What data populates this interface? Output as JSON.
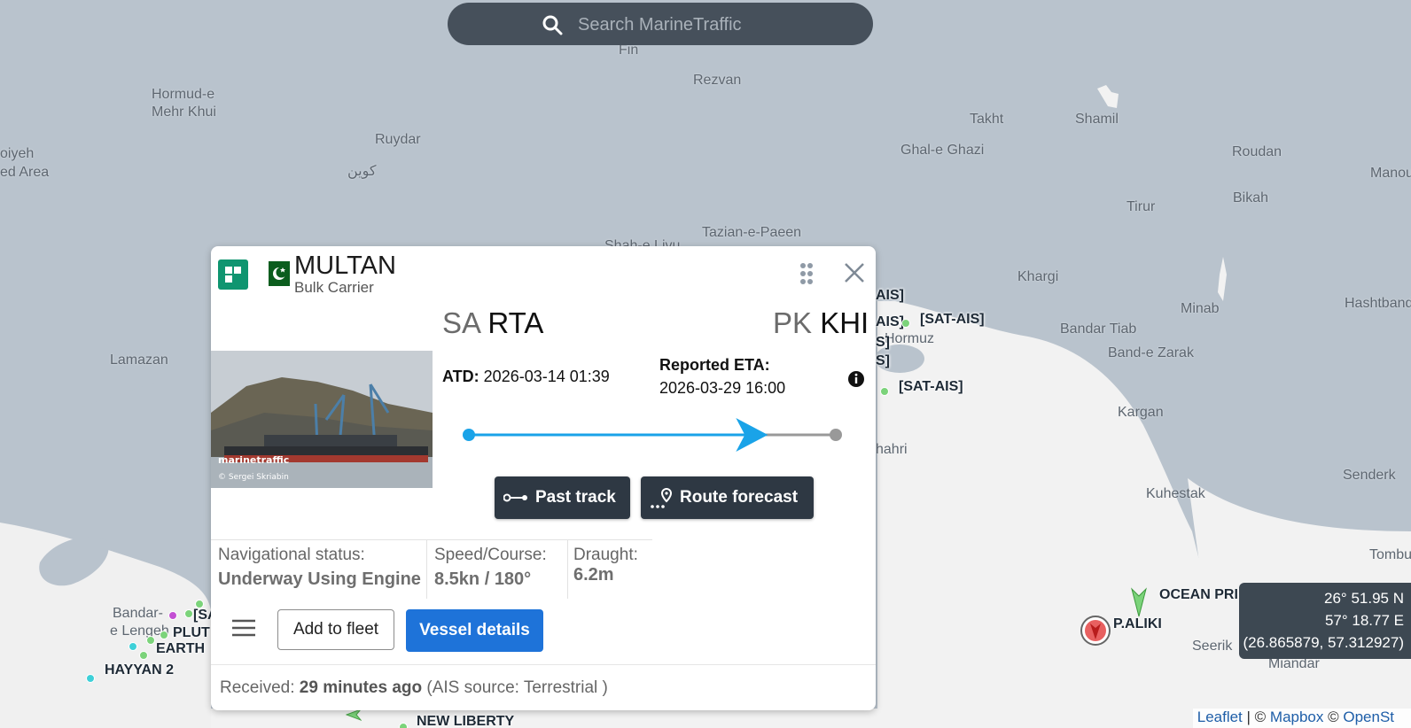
{
  "search": {
    "placeholder": "Search MarineTraffic"
  },
  "map": {
    "places": [
      {
        "text": "Fin"
      },
      {
        "text": "Rezvan"
      },
      {
        "text": "Hormud-e"
      },
      {
        "text": "Mehr Khui"
      },
      {
        "text": "Ruydar"
      },
      {
        "text": "کوین"
      },
      {
        "text": "oiyeh"
      },
      {
        "text": "ed Area"
      },
      {
        "text": "Takht"
      },
      {
        "text": "Shamil"
      },
      {
        "text": "Ghal-e Ghazi"
      },
      {
        "text": "Roudan"
      },
      {
        "text": "Manou"
      },
      {
        "text": "Bikah"
      },
      {
        "text": "Tirur"
      },
      {
        "text": "Tazian-e-Paeen"
      },
      {
        "text": "Shah-e Livu"
      },
      {
        "text": "Khargi"
      },
      {
        "text": "Minab"
      },
      {
        "text": "Hashtband"
      },
      {
        "text": "Bandar Tiab"
      },
      {
        "text": "Band-e Zarak"
      },
      {
        "text": "Lamazan"
      },
      {
        "text": "Hormuz"
      },
      {
        "text": "Kargan"
      },
      {
        "text": "hahri"
      },
      {
        "text": "Kuhestak"
      },
      {
        "text": "Senderk"
      },
      {
        "text": "Tombu"
      },
      {
        "text": "Seerik"
      },
      {
        "text": "Miandar"
      },
      {
        "text": "Bandar-"
      },
      {
        "text": "e Lengeh"
      }
    ],
    "vessel_labels": [
      {
        "text": "[SAT-AIS]"
      },
      {
        "text": "[SAT-AIS]"
      },
      {
        "text": "AIS]"
      },
      {
        "text": "AIS]"
      },
      {
        "text": "S]"
      },
      {
        "text": "S]"
      },
      {
        "text": "OCEAN PRI"
      },
      {
        "text": "P.ALIKI"
      },
      {
        "text": "HAYYAN 2"
      },
      {
        "text": "PLUT"
      },
      {
        "text": "EARTH"
      },
      {
        "text": "[SA"
      },
      {
        "text": "NEW LIBERTY"
      }
    ]
  },
  "popup": {
    "vessel_name": "MULTAN",
    "vessel_type": "Bulk Carrier",
    "flag_icon": "pakistan-flag-icon",
    "origin": {
      "country": "SA",
      "port": "RTA"
    },
    "destination": {
      "country": "PK",
      "port": "KHI"
    },
    "photo": {
      "watermark": "marinetraffic",
      "credit": "© Sergei Skriabin"
    },
    "atd_label": "ATD:",
    "atd_value": "2026-03-14 01:39",
    "eta_label": "Reported ETA:",
    "eta_value": "2026-03-29 16:00",
    "voyage_progress": 0.81,
    "buttons": {
      "past_track": "Past track",
      "route_forecast": "Route forecast",
      "add_to_fleet": "Add to fleet",
      "vessel_details": "Vessel details"
    },
    "stats": {
      "nav_status_label": "Navigational status:",
      "nav_status_value": "Underway Using Engine",
      "speed_label": "Speed/Course:",
      "speed_value": "8.5kn / 180°",
      "draught_label": "Draught:",
      "draught_value": "6.2m"
    },
    "received": {
      "prefix": "Received:",
      "age": "29 minutes ago",
      "source": "(AIS source: Terrestrial )"
    }
  },
  "coords": {
    "lat": "26° 51.95 N",
    "lon": "57° 18.77 E",
    "decimal": "(26.865879, 57.312927)"
  },
  "attribution": {
    "leaflet": "Leaflet",
    "sep": " | © ",
    "mapbox": "Mapbox",
    "osm_prefix": " © ",
    "osm": "OpenSt"
  },
  "colors": {
    "accent": "#1e73d9",
    "progress": "#1aa3e8",
    "dark_button": "#2e3843",
    "vessel_icon": "#0f9570"
  }
}
